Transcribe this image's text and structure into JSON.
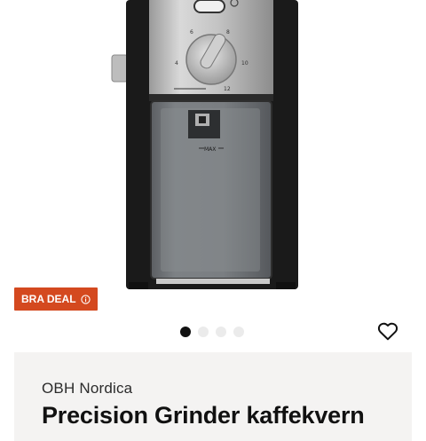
{
  "product": {
    "images": [
      {
        "alt": "OBH Nordica Precision Grinder kaffekvern",
        "active": true
      },
      {
        "active": false
      },
      {
        "active": false
      },
      {
        "active": false
      }
    ],
    "dial_labels": [
      "6",
      "8",
      "4",
      "10",
      "12"
    ],
    "max_label": "MAX",
    "badge": {
      "label": "BRA DEAL",
      "color": "#d4491f"
    },
    "favorite_icon": "heart-outline-icon",
    "brand": "OBH Nordica",
    "title": "Precision Grinder kaffekvern"
  }
}
